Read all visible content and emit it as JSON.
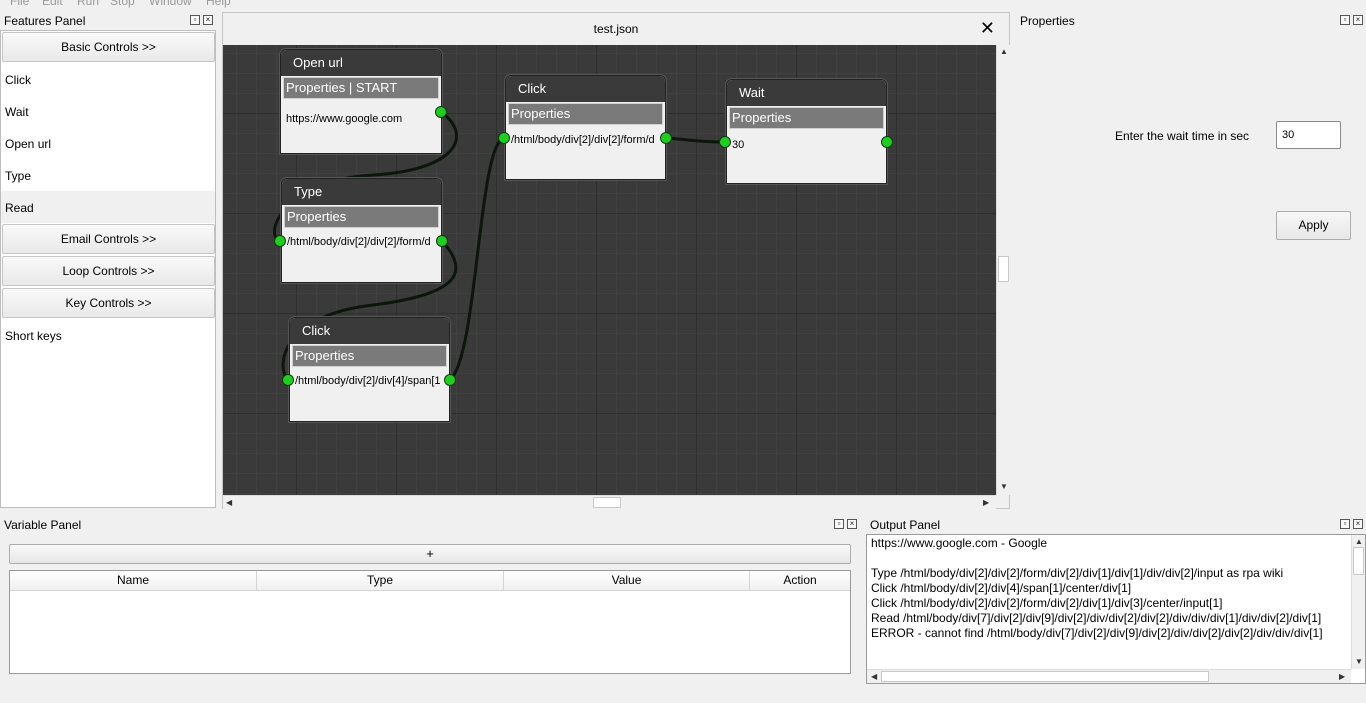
{
  "menu": [
    "File",
    "Edit",
    "Run",
    "Stop",
    "Window",
    "Help"
  ],
  "features_panel": {
    "title": "Features Panel",
    "items": [
      {
        "type": "button",
        "label": "Basic Controls >>"
      },
      {
        "type": "item",
        "label": "Click"
      },
      {
        "type": "item",
        "label": "Wait"
      },
      {
        "type": "item",
        "label": "Open url"
      },
      {
        "type": "item",
        "label": "Type"
      },
      {
        "type": "item",
        "label": "Read"
      },
      {
        "type": "button",
        "label": "Email Controls >>"
      },
      {
        "type": "button",
        "label": "Loop Controls >>"
      },
      {
        "type": "button",
        "label": "Key Controls >>"
      },
      {
        "type": "item",
        "label": "Short keys"
      }
    ]
  },
  "editor": {
    "tab_title": "test.json",
    "close_symbol": "✕",
    "nodes": [
      {
        "title": "Open url",
        "props": "Properties | START",
        "value": "https://www.google.com"
      },
      {
        "title": "Type",
        "props": "Properties",
        "value": "/html/body/div[2]/div[2]/form/d"
      },
      {
        "title": "Click",
        "props": "Properties",
        "value": "/html/body/div[2]/div[4]/span[1"
      },
      {
        "title": "Click",
        "props": "Properties",
        "value": "/html/body/div[2]/div[2]/form/d"
      },
      {
        "title": "Wait",
        "props": "Properties",
        "value": "30"
      }
    ]
  },
  "properties_panel": {
    "title": "Properties",
    "label": "Enter the wait time in sec",
    "wait_value": "30",
    "apply_label": "Apply"
  },
  "variable_panel": {
    "title": "Variable Panel",
    "add_label": "+",
    "columns": [
      "Name",
      "Type",
      "Value",
      "Action"
    ]
  },
  "output_panel": {
    "title": "Output Panel",
    "lines": [
      "https://www.google.com - Google",
      "",
      "Type /html/body/div[2]/div[2]/form/div[2]/div[1]/div[1]/div/div[2]/input as rpa wiki",
      "Click /html/body/div[2]/div[4]/span[1]/center/div[1]",
      "Click /html/body/div[2]/div[2]/form/div[2]/div[1]/div[3]/center/input[1]",
      "Read /html/body/div[7]/div[2]/div[9]/div[2]/div/div[2]/div[2]/div/div/div[1]/div/div[2]/div[1]",
      "ERROR - cannot find /html/body/div[7]/div[2]/div[9]/div[2]/div/div[2]/div[2]/div/div/div[1]"
    ]
  }
}
